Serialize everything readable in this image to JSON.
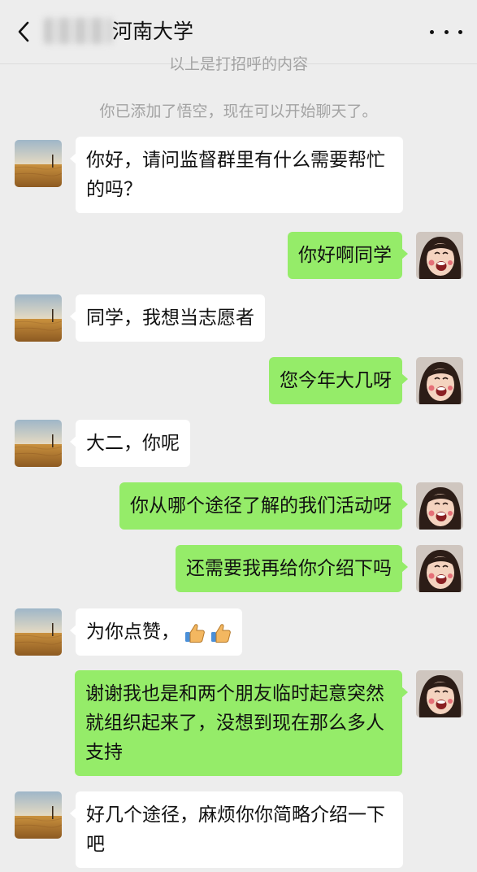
{
  "header": {
    "title": "河南大学",
    "back_icon": "chevron-left-icon",
    "more_icon": "more-dots-icon"
  },
  "system": {
    "greeting_clipped": "以上是打招呼的内容",
    "added_notice": "你已添加了悟空，现在可以开始聊天了。"
  },
  "messages": [
    {
      "from": "them",
      "text": "你好，请问监督群里有什么需要帮忙的吗？"
    },
    {
      "from": "me",
      "text": "你好啊同学"
    },
    {
      "from": "them",
      "text": "同学，我想当志愿者"
    },
    {
      "from": "me",
      "text": "您今年大几呀"
    },
    {
      "from": "them",
      "text": "大二，你呢"
    },
    {
      "from": "me",
      "text": "你从哪个途径了解的我们活动呀"
    },
    {
      "from": "me",
      "text": "还需要我再给你介绍下吗"
    },
    {
      "from": "them",
      "text": "为你点赞，",
      "emoji": [
        "thumbs-up-icon",
        "thumbs-up-icon"
      ]
    },
    {
      "from": "me",
      "text": "谢谢我也是和两个朋友临时起意突然就组织起来了，没想到现在那么多人支持"
    },
    {
      "from": "them",
      "text": "好几个途径，麻烦你你简略介绍一下吧"
    }
  ],
  "colors": {
    "background": "#ededed",
    "incoming_bubble": "#ffffff",
    "outgoing_bubble": "#95ec69",
    "system_text": "#a3a3a3"
  }
}
